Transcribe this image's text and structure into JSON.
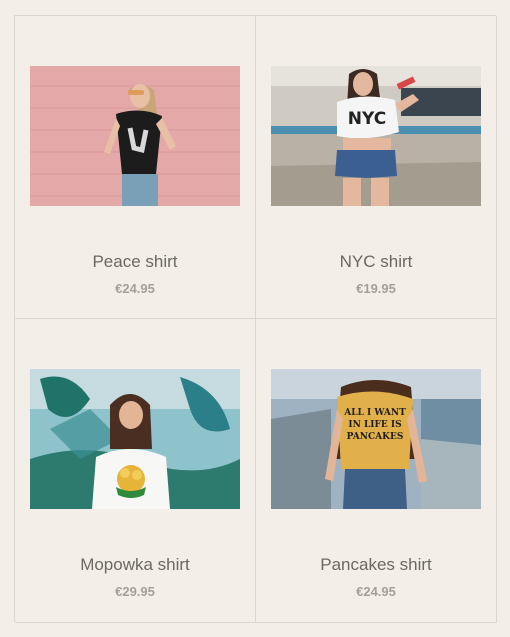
{
  "products": [
    {
      "name": "Peace shirt",
      "price": "€24.95",
      "image": "photo-woman-black-peace-tee-pink-wall"
    },
    {
      "name": "NYC shirt",
      "price": "€19.95",
      "image": "photo-woman-white-nyc-tee-street"
    },
    {
      "name": "Mopowka shirt",
      "price": "€29.95",
      "image": "photo-woman-white-flower-tee-graffiti"
    },
    {
      "name": "Pancakes shirt",
      "price": "€24.95",
      "image": "photo-woman-yellow-pancakes-tee-bridge"
    }
  ],
  "shirt_texts": {
    "nyc": "NYC",
    "pancakes": "ALL I WANT IN LIFE IS PANCAKES"
  }
}
